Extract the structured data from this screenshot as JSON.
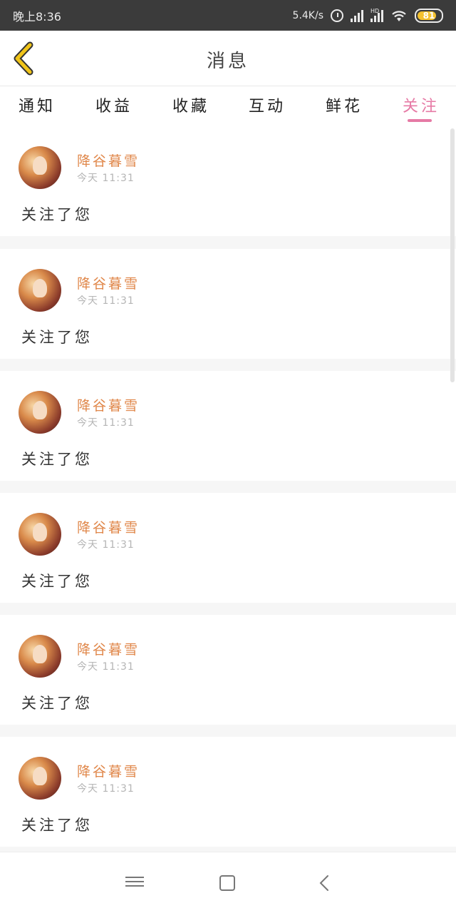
{
  "status_bar": {
    "time": "晚上8:36",
    "net_speed": "5.4K/s",
    "hd_label": "HD",
    "battery": "81"
  },
  "header": {
    "title": "消息"
  },
  "tabs": [
    {
      "label": "通知",
      "active": false
    },
    {
      "label": "收益",
      "active": false
    },
    {
      "label": "收藏",
      "active": false
    },
    {
      "label": "互动",
      "active": false
    },
    {
      "label": "鲜花",
      "active": false
    },
    {
      "label": "关注",
      "active": true
    }
  ],
  "notifications": [
    {
      "user": "降谷暮雪",
      "time": "今天 11:31",
      "message": "关注了您"
    },
    {
      "user": "降谷暮雪",
      "time": "今天 11:31",
      "message": "关注了您"
    },
    {
      "user": "降谷暮雪",
      "time": "今天 11:31",
      "message": "关注了您"
    },
    {
      "user": "降谷暮雪",
      "time": "今天 11:31",
      "message": "关注了您"
    },
    {
      "user": "降谷暮雪",
      "time": "今天 11:31",
      "message": "关注了您"
    },
    {
      "user": "降谷暮雪",
      "time": "今天 11:31",
      "message": "关注了您"
    }
  ],
  "colors": {
    "accent": "#e67aa5",
    "name": "#e0874a",
    "back_arrow": "#f0c419"
  }
}
